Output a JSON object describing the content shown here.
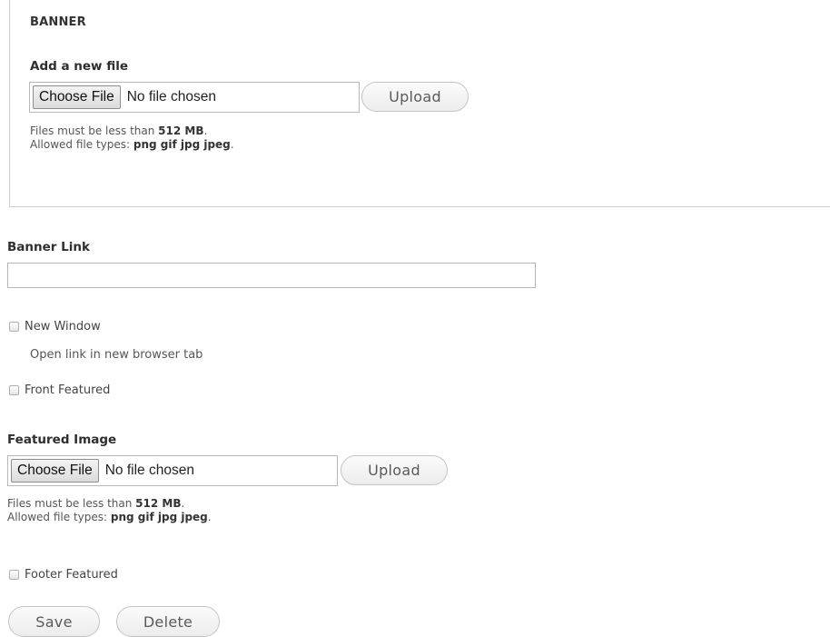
{
  "banner": {
    "legend": "BANNER",
    "add_label": "Add a new file",
    "choose_label": "Choose File",
    "no_file_text": "No file chosen",
    "upload_label": "Upload",
    "size_prefix": "Files must be less than ",
    "size_value": "512 MB",
    "size_suffix": ".",
    "types_prefix": "Allowed file types: ",
    "types_value": "png gif jpg jpeg",
    "types_suffix": "."
  },
  "banner_link": {
    "label": "Banner Link",
    "value": ""
  },
  "new_window": {
    "label": "New Window",
    "checked": false,
    "help": "Open link in new browser tab"
  },
  "front_featured": {
    "label": "Front Featured",
    "checked": false
  },
  "featured_image": {
    "label": "Featured Image",
    "choose_label": "Choose File",
    "no_file_text": "No file chosen",
    "upload_label": "Upload",
    "size_prefix": "Files must be less than ",
    "size_value": "512 MB",
    "size_suffix": ".",
    "types_prefix": "Allowed file types: ",
    "types_value": "png gif jpg jpeg",
    "types_suffix": "."
  },
  "footer_featured": {
    "label": "Footer Featured",
    "checked": false
  },
  "actions": {
    "save_label": "Save",
    "delete_label": "Delete"
  }
}
